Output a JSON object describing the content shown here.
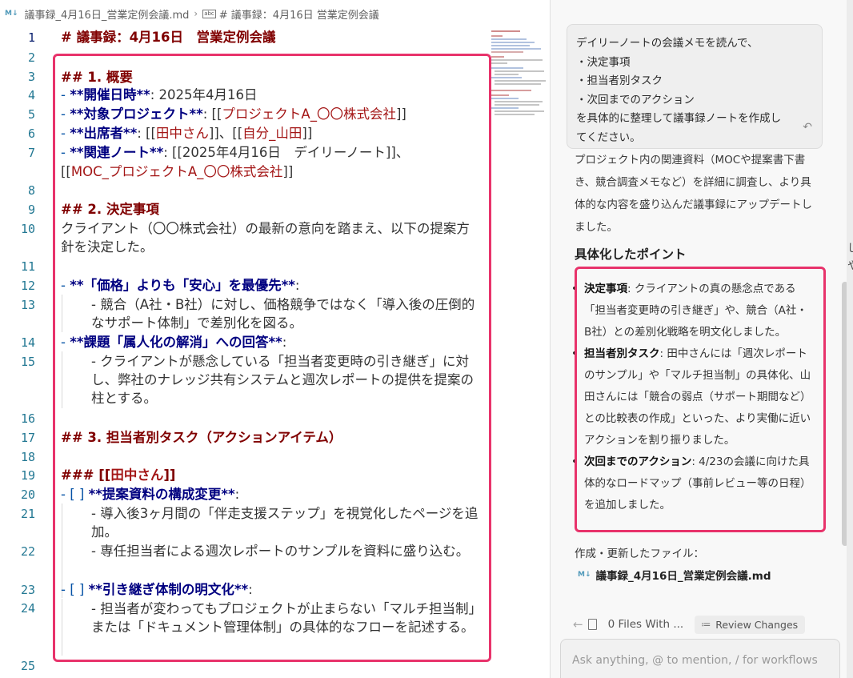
{
  "editor": {
    "breadcrumb": {
      "file_badge": "M↓",
      "file": "議事録_4月16日_営業定例会議.md",
      "sep": "›",
      "symbol_badge": "abc",
      "symbol": "# 議事録：4月16日 営業定例会議"
    },
    "line_numbers": [
      "1",
      "2",
      "3",
      "4",
      "5",
      "6",
      "7",
      "8",
      "9",
      "10",
      "11",
      "12",
      "13",
      "14",
      "15",
      "16",
      "17",
      "18",
      "19",
      "20",
      "21",
      "22",
      "23",
      "24",
      "25"
    ],
    "lines": {
      "l1": "# 議事録：4月16日　営業定例会議",
      "l3": "## 1. 概要",
      "l4_dash": "- ",
      "l4_key": "**開催日時**",
      "l4_val": ": 2025年4月16日",
      "l5_dash": "- ",
      "l5_key": "**対象プロジェクト**",
      "l5_pre": ": [[",
      "l5_link": "プロジェクトA_〇〇株式会社",
      "l5_post": "]]",
      "l6_dash": "- ",
      "l6_key": "**出席者**",
      "l6_pre": ": [[",
      "l6_link1": "田中さん",
      "l6_mid": "]]、[[",
      "l6_link2": "自分_山田",
      "l6_post": "]]",
      "l7_dash": "- ",
      "l7_key": "**関連ノート**",
      "l7_val": ": [[2025年4月16日　デイリーノート]]、",
      "l7b_pre": "[[",
      "l7b_link": "MOC_プロジェクトA_〇〇株式会社",
      "l7b_post": "]]",
      "l9": "## 2. 決定事項",
      "l10": "クライアント（〇〇株式会社）の最新の意向を踏まえ、以下の提案方針を決定した。",
      "l12_dash": "- ",
      "l12_key": "**「価格」よりも「安心」を最優先**",
      "l12_colon": ":",
      "l13": "- 競合（A社・B社）に対し、価格競争ではなく「導入後の圧倒的なサポート体制」で差別化を図る。",
      "l14_dash": "- ",
      "l14_key": "**課題「属人化の解消」への回答**",
      "l14_colon": ":",
      "l15": "- クライアントが懸念している「担当者変更時の引き継ぎ」に対し、弊社のナレッジ共有システムと週次レポートの提供を提案の柱とする。",
      "l17": "## 3. 担当者別タスク（アクションアイテム）",
      "l19_pre": "### [[",
      "l19_link": "田中さん",
      "l19_post": "]]",
      "l20_dash": "- [ ] ",
      "l20_key": "**提案資料の構成変更**",
      "l20_colon": ":",
      "l21": "- 導入後3ヶ月間の「伴走支援ステップ」を視覚化したページを追加。",
      "l22": "- 専任担当者による週次レポートのサンプルを資料に盛り込む。",
      "l23_dash": "- [ ] ",
      "l23_key": "**引き継ぎ体制の明文化**",
      "l23_colon": ":",
      "l24": "- 担当者が変わってもプロジェクトが止まらない「マルチ担当制」または「ドキュメント管理体制」の具体的なフローを記述する。"
    }
  },
  "chat": {
    "prompt": {
      "line1": "デイリーノートの会議メモを読んで、",
      "line2": "・決定事項",
      "line3": "・担当者別タスク",
      "line4": "・次回までのアクション",
      "line5": "を具体的に整理して議事録ノートを作成し",
      "line6": "てください。",
      "undo_icon": "↶"
    },
    "response_intro": "プロジェクト内の関連資料（MOCや提案書下書き、競合調査メモなど）を詳細に調査し、より具体的な内容を盛り込んだ議事録にアップデートしました。",
    "section_heading": "具体化したポイント",
    "points": [
      {
        "label": "決定事項",
        "text": ": クライアントの真の懸念点である「担当者変更時の引き継ぎ」や、競合（A社・B社）との差別化戦略を明文化しました。"
      },
      {
        "label": "担当者別タスク",
        "text": ": 田中さんには「週次レポートのサンプル」や「マルチ担当制」の具体化、山田さんには「競合の弱点（サポート期間など）との比較表の作成」といった、より実働に近いアクションを割り振りました。"
      },
      {
        "label": "次回までのアクション",
        "text": ": 4/23の会議に向けた具体的なロードマップ（事前レビュー等の日程）を追加しました。"
      }
    ],
    "files_label": "作成・更新したファイル：",
    "file_badge": "M↓",
    "file_name": "議事録_4月16日_営業定例会議.md",
    "files_bar": {
      "back": "←",
      "files_with": "0 Files With ...",
      "review_icon": "≔",
      "review_label": "Review Changes"
    },
    "input_placeholder": "Ask anything, @ to mention, / for workflows"
  },
  "colors": {
    "highlight_box": "#e8336b",
    "heading": "#800000",
    "bold_text": "#000080",
    "link_text": "#a31515",
    "line_number": "#237893"
  },
  "edge_glyph": "し\nや"
}
